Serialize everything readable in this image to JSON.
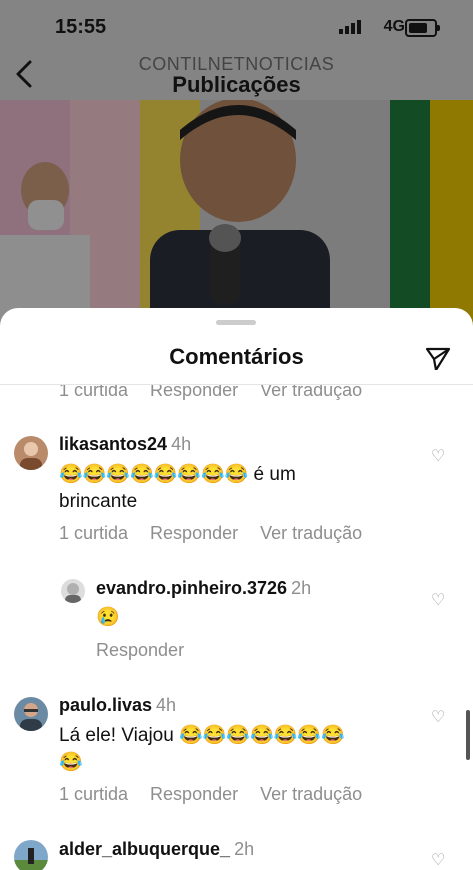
{
  "status": {
    "time": "15:55",
    "network": "4G"
  },
  "header": {
    "account": "CONTILNETNOTICIAS",
    "title": "Publicações"
  },
  "sheet": {
    "title": "Comentários"
  },
  "top_actions": {
    "likes": "1 curtida",
    "reply": "Responder",
    "translate": "Ver tradução"
  },
  "comments": [
    {
      "user": "likasantos24",
      "time": "4h",
      "line1": "😂😂😂😂😂😂😂😂 é um",
      "line2": "brincante",
      "likes": "1 curtida",
      "reply": "Responder",
      "translate": "Ver tradução"
    },
    {
      "user": "evandro.pinheiro.3726",
      "time": "2h",
      "text": "😢",
      "reply": "Responder"
    },
    {
      "user": "paulo.livas",
      "time": "4h",
      "line1": "Lá ele! Viajou 😂😂😂😂😂😂😂",
      "line2": "😂",
      "likes": "1 curtida",
      "reply": "Responder",
      "translate": "Ver tradução"
    },
    {
      "user": "alder_albuquerque_",
      "time": "2h"
    }
  ],
  "icons": {
    "back": "chevron-left-icon",
    "send": "paper-plane-icon",
    "heart": "heart-outline-icon"
  },
  "colors": {
    "meta": "#8e8e8e",
    "text": "#111111"
  }
}
